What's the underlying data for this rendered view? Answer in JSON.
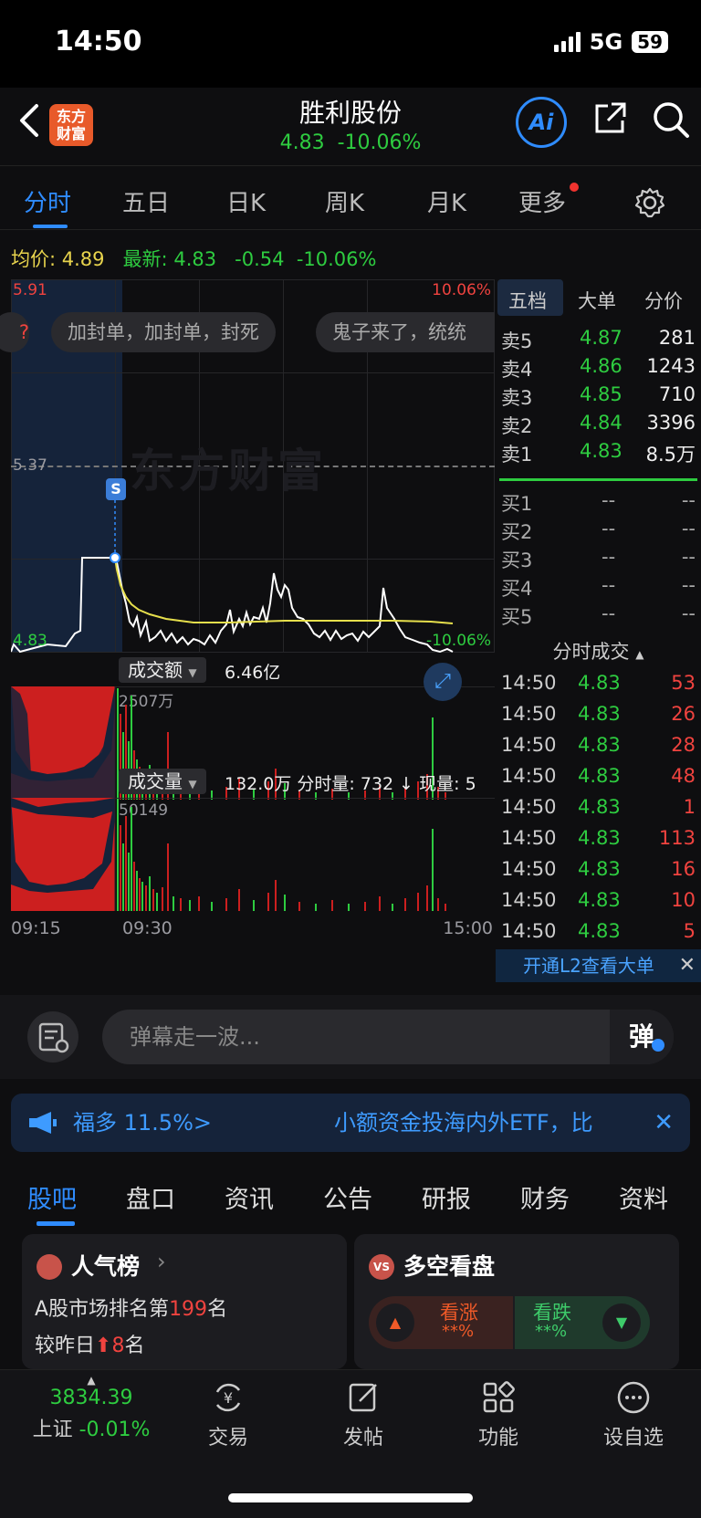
{
  "status": {
    "time": "14:50",
    "network": "5G",
    "battery": "59"
  },
  "header": {
    "logo_line1": "东方",
    "logo_line2": "财富",
    "title": "胜利股份",
    "price": "4.83",
    "change_pct": "-10.06%",
    "ai_label": "Ai"
  },
  "ktabs": [
    "分时",
    "五日",
    "日K",
    "周K",
    "月K",
    "更多"
  ],
  "info": {
    "avg_label": "均价:",
    "avg": "4.89",
    "last_label": "最新:",
    "last": "4.83",
    "change": "-0.54",
    "change_pct": "-10.06%"
  },
  "chart": {
    "price_high": "5.91",
    "price_mid": "5.37",
    "price_low": "4.83",
    "pct_high": "10.06%",
    "pct_low": "-10.06%",
    "watermark": "东方财富",
    "marker": "S",
    "chip1": "加封单，加封单，封死",
    "chip2": "鬼子来了，统统",
    "amount_label": "成交额",
    "amount_value": "6.46亿",
    "amount_max": "2507万",
    "volume_label": "成交量",
    "volume_value": "132.0万 分时量: 732 ↓ 现量: 5",
    "volume_max": "50149",
    "time_start": "09:15",
    "time_open": "09:30",
    "time_end": "15:00"
  },
  "book": {
    "tabs": [
      "五档",
      "大单",
      "分价"
    ],
    "asks": [
      {
        "label": "卖5",
        "price": "4.87",
        "vol": "281"
      },
      {
        "label": "卖4",
        "price": "4.86",
        "vol": "1243"
      },
      {
        "label": "卖3",
        "price": "4.85",
        "vol": "710"
      },
      {
        "label": "卖2",
        "price": "4.84",
        "vol": "3396"
      },
      {
        "label": "卖1",
        "price": "4.83",
        "vol": "8.5万"
      }
    ],
    "bids": [
      {
        "label": "买1",
        "price": "--",
        "vol": "--"
      },
      {
        "label": "买2",
        "price": "--",
        "vol": "--"
      },
      {
        "label": "买3",
        "price": "--",
        "vol": "--"
      },
      {
        "label": "买4",
        "price": "--",
        "vol": "--"
      },
      {
        "label": "买5",
        "price": "--",
        "vol": "--"
      }
    ],
    "ticks_title": "分时成交",
    "ticks": [
      {
        "time": "14:50",
        "price": "4.83",
        "vol": "53"
      },
      {
        "time": "14:50",
        "price": "4.83",
        "vol": "26"
      },
      {
        "time": "14:50",
        "price": "4.83",
        "vol": "28"
      },
      {
        "time": "14:50",
        "price": "4.83",
        "vol": "48"
      },
      {
        "time": "14:50",
        "price": "4.83",
        "vol": "1"
      },
      {
        "time": "14:50",
        "price": "4.83",
        "vol": "113"
      },
      {
        "time": "14:50",
        "price": "4.83",
        "vol": "16"
      },
      {
        "time": "14:50",
        "price": "4.83",
        "vol": "10"
      },
      {
        "time": "14:50",
        "price": "4.83",
        "vol": "5"
      }
    ],
    "l2": "开通L2查看大单"
  },
  "danmu": {
    "placeholder": "弹幕走一波...",
    "button": "弹"
  },
  "ad": {
    "left": "福多 11.5%>",
    "right": "小额资金投海内外ETF，比"
  },
  "btabs": [
    "股吧",
    "盘口",
    "资讯",
    "公告",
    "研报",
    "财务",
    "资料"
  ],
  "card1": {
    "title": "人气榜",
    "line1_pre": "A股市场排名第",
    "rank": "199",
    "line1_post": "名",
    "line2_pre": "较昨日",
    "delta": "8",
    "line2_post": "名"
  },
  "card2": {
    "title": "多空看盘",
    "up_label": "看涨",
    "up_val": "**%",
    "down_label": "看跌",
    "down_val": "**%"
  },
  "nav": {
    "index_value": "3834.39",
    "index_name": "上证",
    "index_change": "-0.01%",
    "items": [
      "交易",
      "发帖",
      "功能",
      "设自选"
    ]
  }
}
